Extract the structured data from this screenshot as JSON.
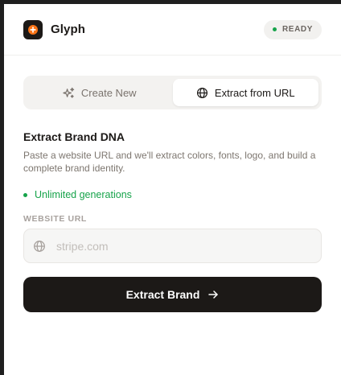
{
  "header": {
    "app_name": "Glyph",
    "logo_icon": "orange-flower-icon",
    "status": "READY"
  },
  "tabs": [
    {
      "label": "Create New",
      "icon": "sparkles-icon",
      "active": false
    },
    {
      "label": "Extract from URL",
      "icon": "globe-icon",
      "active": true
    }
  ],
  "section": {
    "title": "Extract Brand DNA",
    "description": "Paste a website URL and we'll extract colors, fonts, logo, and build a complete brand identity."
  },
  "generations": {
    "label": "Unlimited generations"
  },
  "url_field": {
    "label": "WEBSITE URL",
    "value": "",
    "placeholder": "stripe.com",
    "icon": "globe-icon"
  },
  "cta": {
    "label": "Extract Brand",
    "icon": "arrow-right-icon"
  },
  "colors": {
    "accent": "#f97316",
    "status_green": "#16a34a",
    "dark": "#1c1917"
  }
}
